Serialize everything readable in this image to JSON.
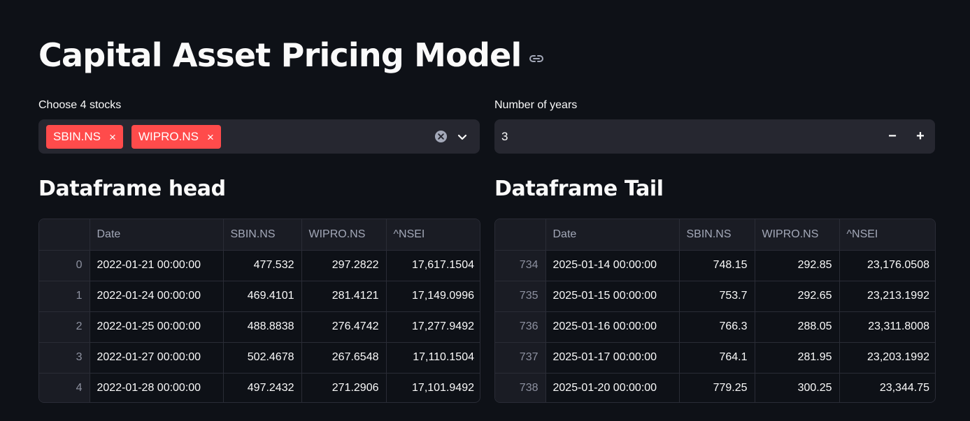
{
  "title": "Capital Asset Pricing Model",
  "stocks_select": {
    "label": "Choose 4 stocks",
    "selected": [
      "SBIN.NS",
      "WIPRO.NS"
    ],
    "remove_glyph": "×"
  },
  "years_input": {
    "label": "Number of years",
    "value": "3",
    "decrement": "−",
    "increment": "+"
  },
  "head_section": {
    "heading": "Dataframe head",
    "columns": [
      "",
      "Date",
      "SBIN.NS",
      "WIPRO.NS",
      "^NSEI"
    ],
    "rows": [
      [
        "0",
        "2022-01-21 00:00:00",
        "477.532",
        "297.2822",
        "17,617.1504"
      ],
      [
        "1",
        "2022-01-24 00:00:00",
        "469.4101",
        "281.4121",
        "17,149.0996"
      ],
      [
        "2",
        "2022-01-25 00:00:00",
        "488.8838",
        "276.4742",
        "17,277.9492"
      ],
      [
        "3",
        "2022-01-27 00:00:00",
        "502.4678",
        "267.6548",
        "17,110.1504"
      ],
      [
        "4",
        "2022-01-28 00:00:00",
        "497.2432",
        "271.2906",
        "17,101.9492"
      ]
    ]
  },
  "tail_section": {
    "heading": "Dataframe Tail",
    "columns": [
      "",
      "Date",
      "SBIN.NS",
      "WIPRO.NS",
      "^NSEI"
    ],
    "rows": [
      [
        "734",
        "2025-01-14 00:00:00",
        "748.15",
        "292.85",
        "23,176.0508"
      ],
      [
        "735",
        "2025-01-15 00:00:00",
        "753.7",
        "292.65",
        "23,213.1992"
      ],
      [
        "736",
        "2025-01-16 00:00:00",
        "766.3",
        "288.05",
        "23,311.8008"
      ],
      [
        "737",
        "2025-01-17 00:00:00",
        "764.1",
        "281.95",
        "23,203.1992"
      ],
      [
        "738",
        "2025-01-20 00:00:00",
        "779.25",
        "300.25",
        "23,344.75"
      ]
    ]
  },
  "colors": {
    "background": "#0e1117",
    "tag": "#ff4b4b",
    "input_bg": "#262730"
  }
}
